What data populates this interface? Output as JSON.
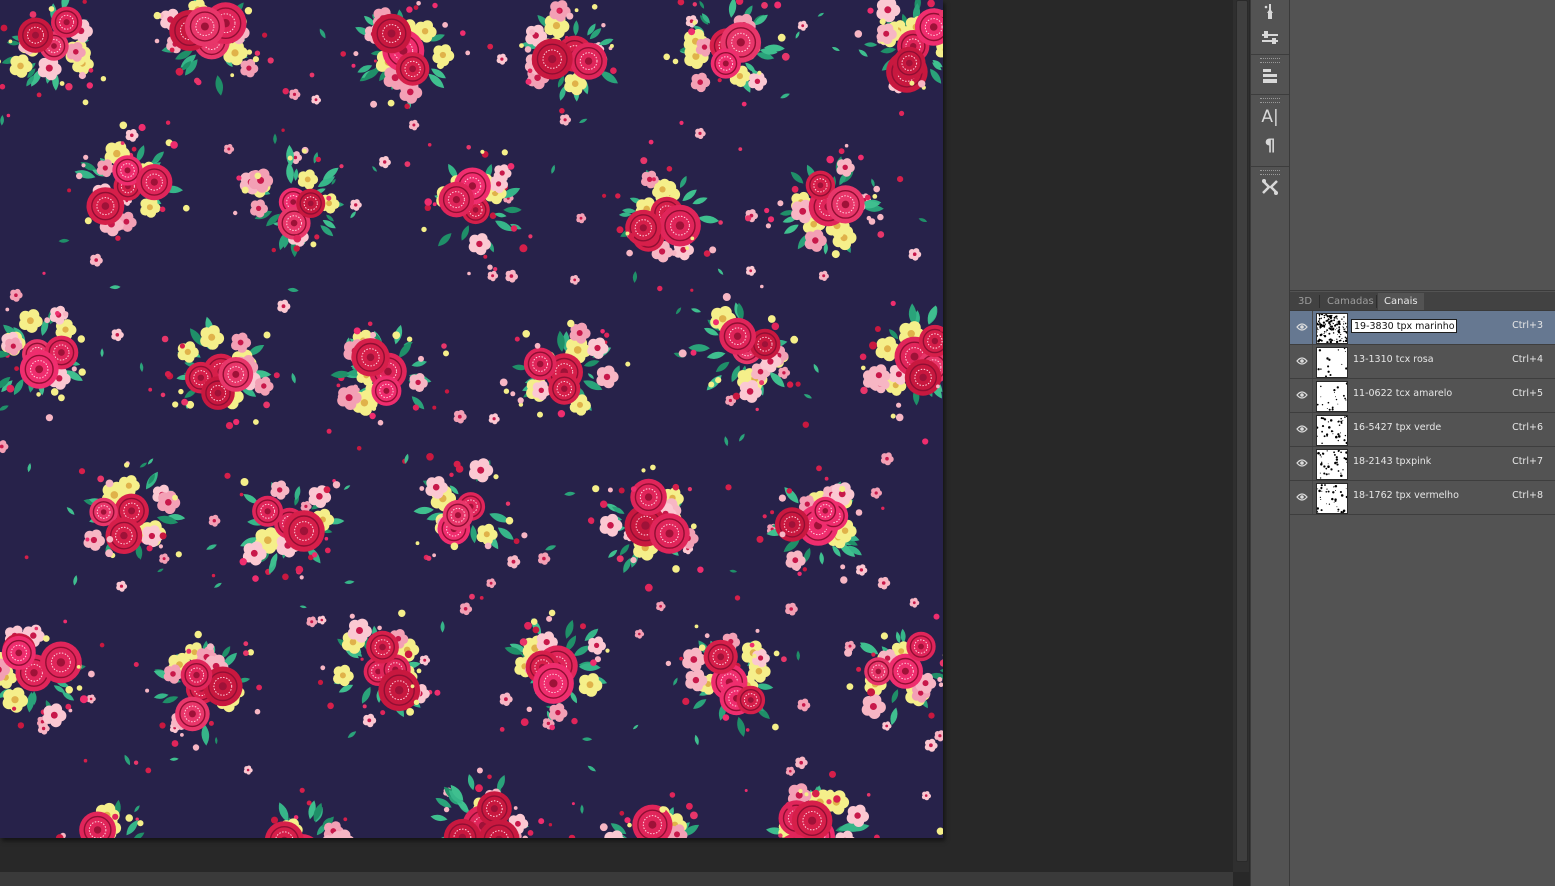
{
  "canvas": {
    "background_color": "#27224a",
    "pattern": "floral-print"
  },
  "toolstrip": {
    "tools": [
      {
        "name": "brush-presets-icon"
      },
      {
        "name": "adjustments-sliders-icon"
      },
      {
        "name": "clone-source-icon"
      },
      {
        "name": "character-icon",
        "glyph": "A|"
      },
      {
        "name": "paragraph-icon",
        "glyph": "¶"
      },
      {
        "name": "tool-presets-icon"
      }
    ]
  },
  "panel": {
    "tabs": [
      {
        "label": "3D",
        "active": false
      },
      {
        "label": "Camadas",
        "active": false
      },
      {
        "label": "Canais",
        "active": true
      }
    ],
    "channels": [
      {
        "name": "19-3830 tpx marinho",
        "shortcut": "Ctrl+3",
        "selected": true,
        "editing": true,
        "density": 0.55
      },
      {
        "name": "13-1310 tcx rosa",
        "shortcut": "Ctrl+4",
        "selected": false,
        "editing": false,
        "density": 0.06
      },
      {
        "name": "11-0622 tcx amarelo",
        "shortcut": "Ctrl+5",
        "selected": false,
        "editing": false,
        "density": 0.08
      },
      {
        "name": "16-5427 tpx verde",
        "shortcut": "Ctrl+6",
        "selected": false,
        "editing": false,
        "density": 0.14
      },
      {
        "name": "18-2143 tpxpink",
        "shortcut": "Ctrl+7",
        "selected": false,
        "editing": false,
        "density": 0.16
      },
      {
        "name": "18-1762 tpx vermelho",
        "shortcut": "Ctrl+8",
        "selected": false,
        "editing": false,
        "density": 0.16
      }
    ]
  }
}
